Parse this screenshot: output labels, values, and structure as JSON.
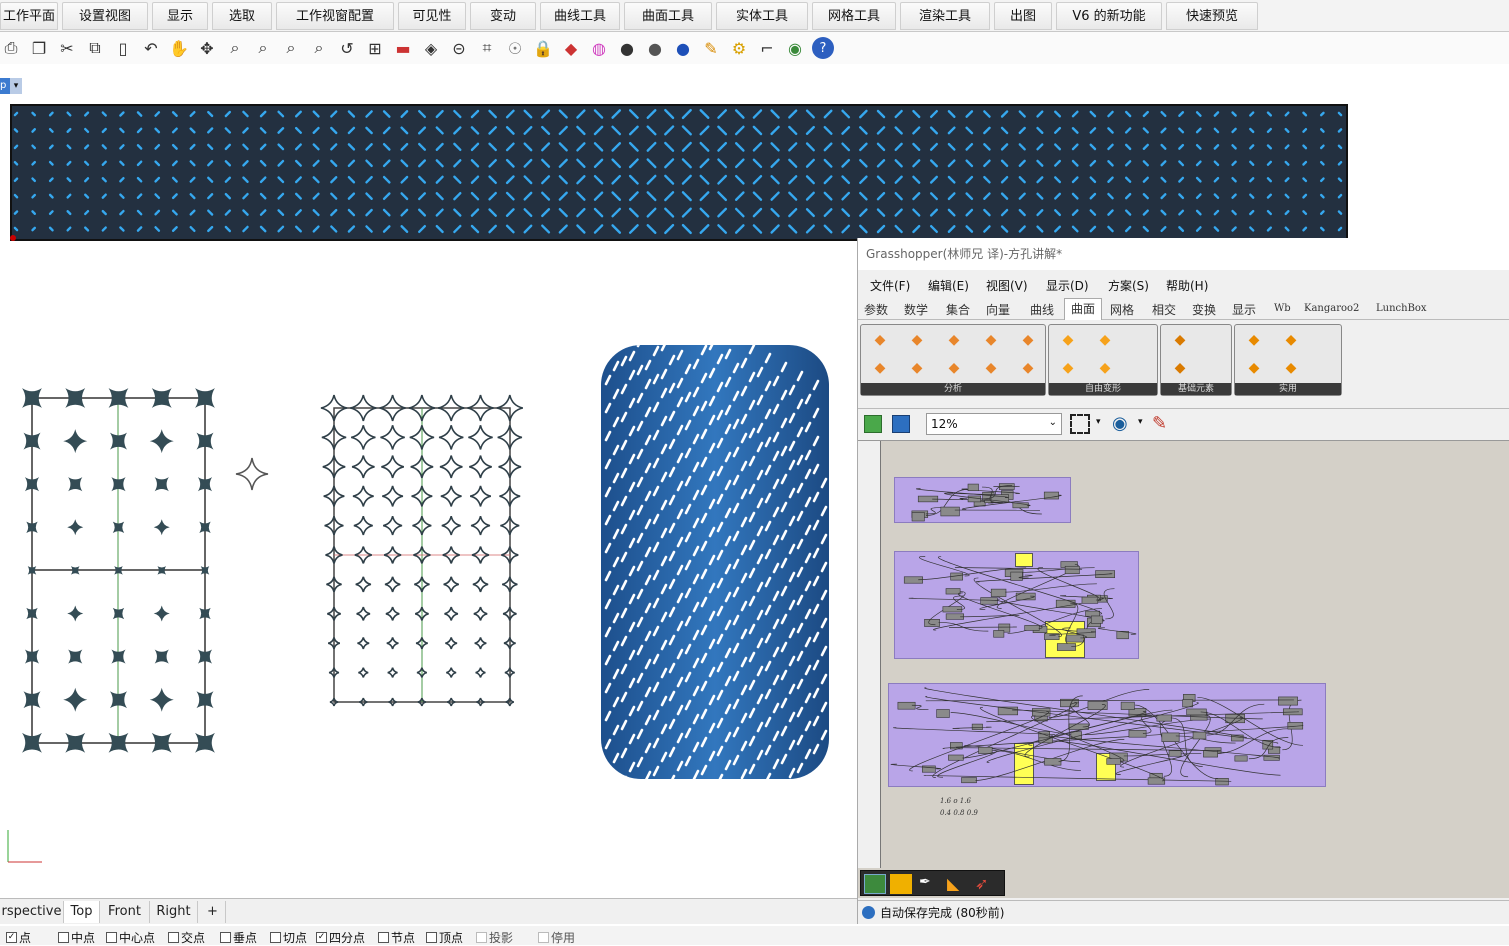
{
  "ribbon_tabs": [
    "工作平面",
    "设置视图",
    "显示",
    "选取",
    "工作视窗配置",
    "可见性",
    "变动",
    "曲线工具",
    "曲面工具",
    "实体工具",
    "网格工具",
    "渲染工具",
    "出图",
    "V6 的新功能",
    "快速预览"
  ],
  "toolbar_icons": [
    "print-icon",
    "new-icon",
    "cut-icon",
    "copy-icon",
    "paste-icon",
    "undo-icon",
    "pan-icon",
    "rotate-icon",
    "zoom-icon",
    "zoom-window-icon",
    "zoom-extents-icon",
    "zoom-selected-icon",
    "undo-view-icon",
    "four-views-icon",
    "car-icon",
    "car2-icon",
    "grid-icon",
    "analyze-icon",
    "light-icon",
    "lock-icon",
    "layer-icon",
    "color-wheel-icon",
    "sphere-icon",
    "render-sphere-icon",
    "globe-icon",
    "pen-icon",
    "gear-icon",
    "block-icon",
    "earth-icon",
    "help-icon"
  ],
  "viewport_tabs": [
    "rspective",
    "Top",
    "Front",
    "Right",
    "+"
  ],
  "osnaps": [
    {
      "label": "点",
      "checked": true
    },
    {
      "label": "中点",
      "checked": false
    },
    {
      "label": "中心点",
      "checked": false
    },
    {
      "label": "交点",
      "checked": false
    },
    {
      "label": "垂点",
      "checked": false
    },
    {
      "label": "切点",
      "checked": false
    },
    {
      "label": "四分点",
      "checked": true
    },
    {
      "label": "节点",
      "checked": false
    },
    {
      "label": "顶点",
      "checked": false
    },
    {
      "label": "投影",
      "checked": false
    },
    {
      "label": "停用",
      "checked": false
    }
  ],
  "grasshopper": {
    "title": "Grasshopper(林师兄 译)-方孔讲解*",
    "menu": [
      "文件(F)",
      "编辑(E)",
      "视图(V)",
      "显示(D)",
      "方案(S)",
      "帮助(H)"
    ],
    "component_tabs": [
      "参数",
      "数学",
      "集合",
      "向量",
      "曲线",
      "曲面",
      "网格",
      "相交",
      "变换",
      "显示",
      "Wb",
      "Kangaroo2",
      "LunchBox"
    ],
    "active_tab": "曲面",
    "panels": [
      "分析",
      "自由变形",
      "基础元素",
      "实用"
    ],
    "zoom": "12%",
    "status": "自动保存完成 (80秒前)",
    "canvas_note_1": "1.6 o 1.6",
    "canvas_note_2": "0.4 0.8 0.9"
  },
  "colors": {
    "pattern_bg": "#233040",
    "pattern_hole": "#36a8ef",
    "gh_group": "#b9a5e8",
    "gh_panel": "#ffff55",
    "surface_blue": "#2b6aad"
  }
}
